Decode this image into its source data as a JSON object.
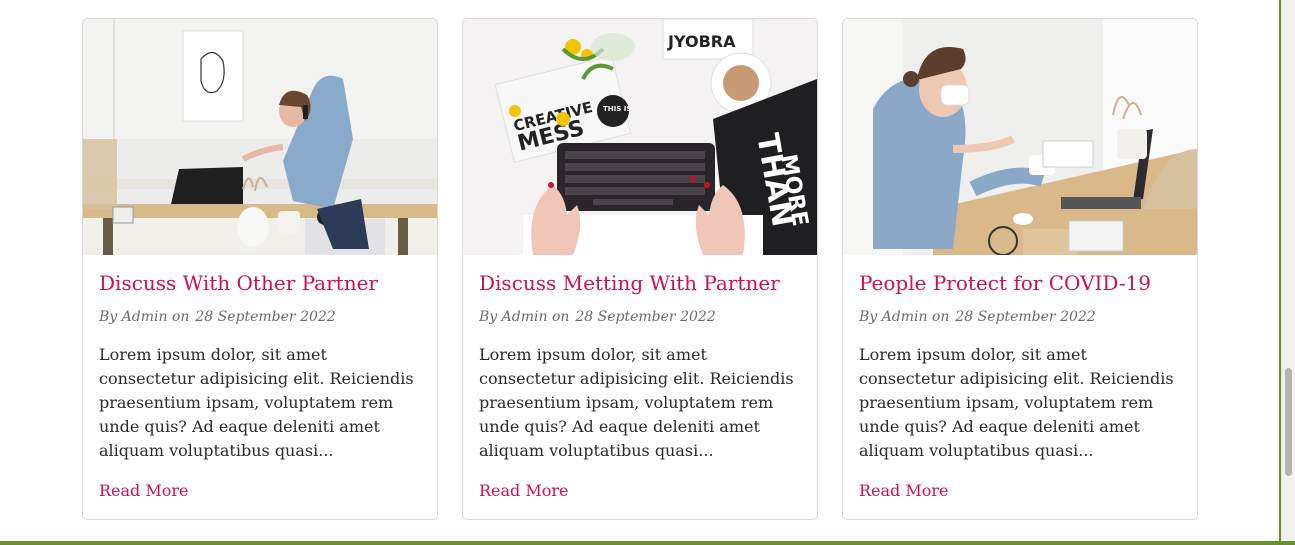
{
  "cards": [
    {
      "title": "Discuss With Other Partner",
      "author": "By Admin on",
      "date": "28 September 2022",
      "excerpt": "Lorem ipsum dolor, sit amet consectetur adipisicing elit. Reiciendis praesentium ipsam, voluptatem rem unde quis? Ad eaque deleniti amet aliquam voluptatibus quasi...",
      "read_more": "Read More",
      "image_alt": "woman-on-phone-at-desk"
    },
    {
      "title": "Discuss Metting With Partner",
      "author": "By Admin on",
      "date": "28 September 2022",
      "excerpt": "Lorem ipsum dolor, sit amet consectetur adipisicing elit. Reiciendis praesentium ipsam, voluptatem rem unde quis? Ad eaque deleniti amet aliquam voluptatibus quasi...",
      "read_more": "Read More",
      "image_alt": "hands-typing-on-keyboard"
    },
    {
      "title": "People Protect for COVID-19",
      "author": "By Admin on",
      "date": "28 September 2022",
      "excerpt": "Lorem ipsum dolor, sit amet consectetur adipisicing elit. Reiciendis praesentium ipsam, voluptatem rem unde quis? Ad eaque deleniti amet aliquam voluptatibus quasi...",
      "read_more": "Read More",
      "image_alt": "woman-with-mask-at-laptop"
    }
  ],
  "colors": {
    "accent": "#d0104c",
    "bottom_bar": "#6a8f2c"
  }
}
